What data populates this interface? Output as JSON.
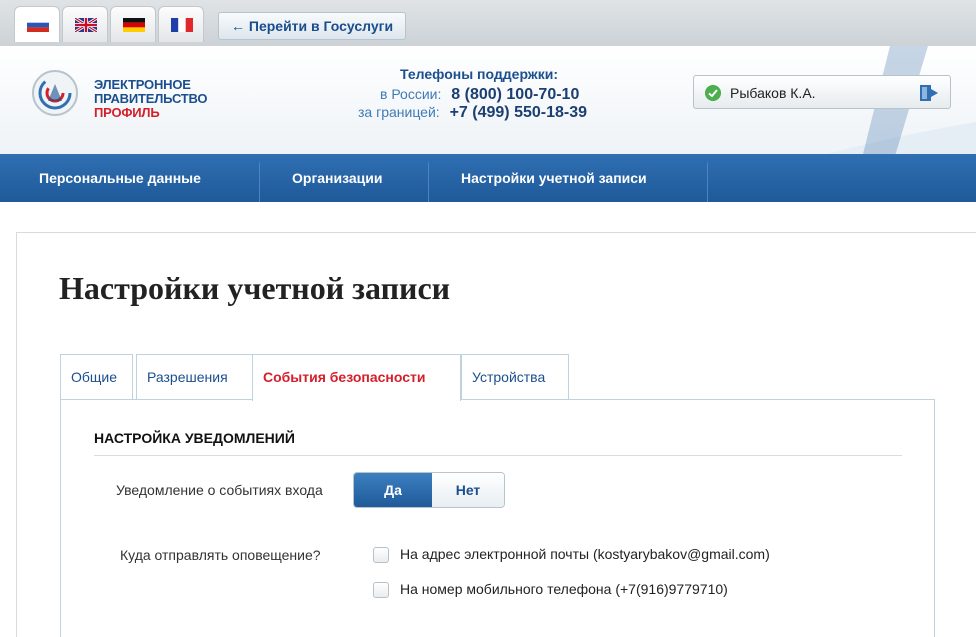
{
  "top": {
    "languages": [
      "ru",
      "en",
      "de",
      "fr"
    ],
    "gosuslugi_link": "← Перейти в Госуслуги"
  },
  "header": {
    "logo_line1": "ЭЛЕКТРОННОЕ",
    "logo_line2": "ПРАВИТЕЛЬСТВО",
    "logo_line3": "ПРОФИЛЬ",
    "support_title": "Телефоны поддержки:",
    "russia_label": "в России:",
    "russia_phone": "8 (800) 100-70-10",
    "abroad_label": "за границей:",
    "abroad_phone": "+7 (499) 550-18-39",
    "user_name": "Рыбаков К.А."
  },
  "nav": {
    "items": [
      "Персональные данные",
      "Организации",
      "Настройки учетной записи"
    ]
  },
  "page": {
    "title": "Настройки учетной записи",
    "tabs": [
      "Общие",
      "Разрешения",
      "События безопасности",
      "Устройства"
    ],
    "active_tab": "События безопасности"
  },
  "notifications": {
    "section_title": "НАСТРОЙКА УВЕДОМЛЕНИЙ",
    "login_events_label": "Уведомление о событиях входа",
    "toggle_yes": "Да",
    "toggle_no": "Нет",
    "toggle_value": "Да",
    "send_where_label": "Куда отправлять оповещение?",
    "option_email": "На адрес электронной почты (kostyarybakov@gmail.com)",
    "option_email_checked": false,
    "option_phone": "На номер мобильного телефона (+7(916)9779710)",
    "option_phone_checked": false
  },
  "colors": {
    "brand_blue": "#1f5a9a",
    "active_tab_red": "#d4202a",
    "status_green": "#4cae4c"
  }
}
